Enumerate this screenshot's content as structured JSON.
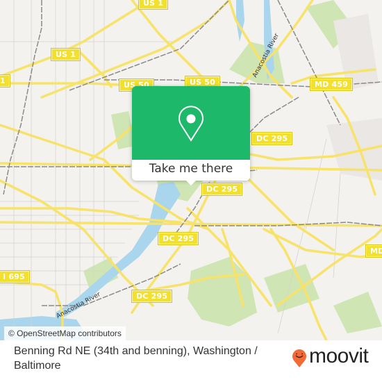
{
  "map": {
    "attribution": "© OpenStreetMap contributors",
    "colors": {
      "background": "#f3f2ee",
      "road": "#f7e36a",
      "water": "#a9d6ec",
      "park": "#cfe5b4",
      "rail": "#888888",
      "shield": "#f2df2e"
    },
    "shields": [
      {
        "id": "us1-top",
        "label": "US 1"
      },
      {
        "id": "us1-mid",
        "label": "US 1"
      },
      {
        "id": "us1-left",
        "label": "1"
      },
      {
        "id": "us50-left",
        "label": "US 50"
      },
      {
        "id": "us50-right",
        "label": "US 50"
      },
      {
        "id": "md459",
        "label": "MD 459"
      },
      {
        "id": "dc295-a",
        "label": "DC 295"
      },
      {
        "id": "dc295-b",
        "label": "DC 295"
      },
      {
        "id": "dc295-c",
        "label": "DC 295"
      },
      {
        "id": "dc295-d",
        "label": "DC 295"
      },
      {
        "id": "i695",
        "label": "I 695"
      },
      {
        "id": "md-right",
        "label": "MD"
      }
    ],
    "river_labels": [
      {
        "id": "anacostia-north",
        "label": "Anacostia River"
      },
      {
        "id": "anacostia-south",
        "label": "Anacostia River"
      }
    ]
  },
  "popup": {
    "icon": "location-pin-icon",
    "button_label": "Take me there",
    "color": "#1eb86a"
  },
  "footer": {
    "title": "Benning Rd NE (34th and benning), Washington / Baltimore",
    "brand": "moovit",
    "brand_color": "#f26a36"
  }
}
